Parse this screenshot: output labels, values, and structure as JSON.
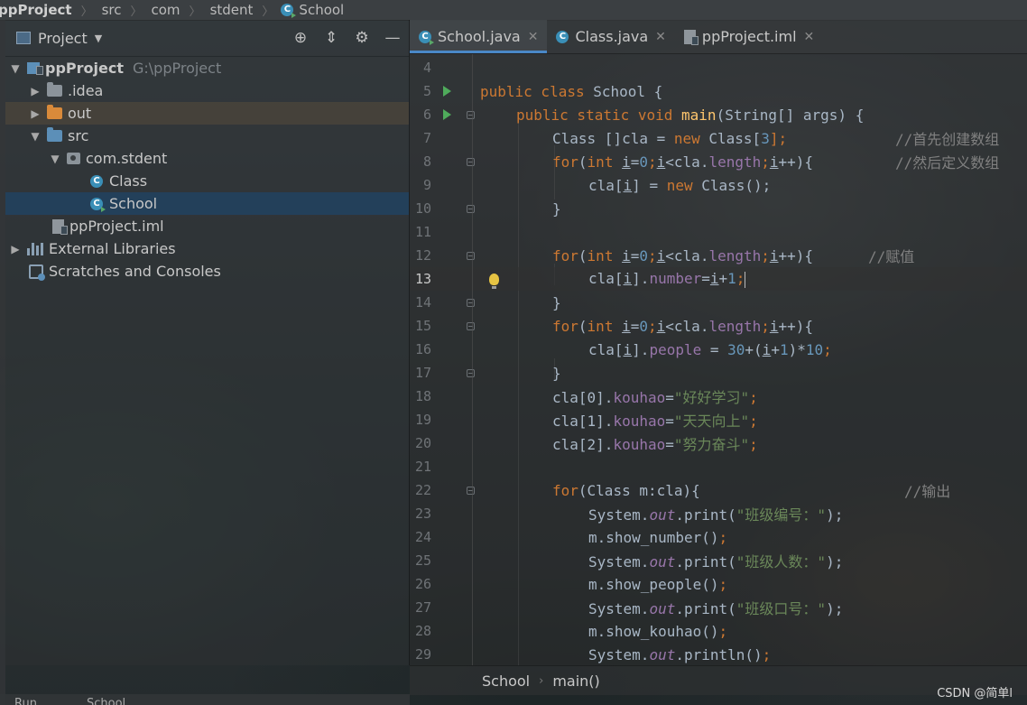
{
  "breadcrumb": [
    "ppProject",
    "src",
    "com",
    "stdent",
    "School"
  ],
  "project_panel": {
    "title": "Project",
    "tree": [
      {
        "label": "ppProject",
        "path": "G:\\ppProject"
      },
      {
        "label": ".idea"
      },
      {
        "label": "out"
      },
      {
        "label": "src"
      },
      {
        "label": "com.stdent"
      },
      {
        "label": "Class"
      },
      {
        "label": "School"
      },
      {
        "label": "ppProject.iml"
      },
      {
        "label": "External Libraries"
      },
      {
        "label": "Scratches and Consoles"
      }
    ]
  },
  "tabs": [
    {
      "label": "School.java",
      "active": true
    },
    {
      "label": "Class.java",
      "active": false
    },
    {
      "label": "ppProject.iml",
      "active": false
    }
  ],
  "line_numbers": [
    "4",
    "5",
    "6",
    "7",
    "8",
    "9",
    "10",
    "11",
    "12",
    "13",
    "14",
    "15",
    "16",
    "17",
    "18",
    "19",
    "20",
    "21",
    "22",
    "23",
    "24",
    "25",
    "26",
    "27",
    "28",
    "29"
  ],
  "code_text": {
    "l5_a": "public class ",
    "l5_b": "School {",
    "l6_a": "public static void ",
    "l6_b": "main(String[] args) {",
    "l7_a": "Class []cla = ",
    "l7_b": "new ",
    "l7_c": "Class[",
    "l7_d": "3",
    "l7_e": "];",
    "l7_cmt": "//首先创建数组",
    "l8_cmt": "//然后定义数组",
    "l9_a": "cla[",
    "l9_b": "i",
    "l9_c": "] = ",
    "l9_d": "new ",
    "l9_e": "Class();",
    "l10": "}",
    "l12_cmt": "//赋值",
    "l13_a": "cla[",
    "l13_b": "i",
    "l13_c": "].",
    "l13_d": "number",
    "l13_e": "=",
    "l13_f": "i",
    "l13_g": "+",
    "l13_h": "1",
    "l13_i": ";",
    "l14": "}",
    "l16_a": "cla[",
    "l16_b": "i",
    "l16_c": "].",
    "l16_d": "people",
    "l16_e": " = ",
    "l16_f": "30",
    "l16_g": "+(",
    "l16_h": "i",
    "l16_i": "+",
    "l16_j": "1",
    "l16_k": ")*",
    "l16_l": "10",
    "l16_m": ";",
    "l17": "}",
    "l18_a": "cla[0].",
    "l18_b": "kouhao",
    "l18_c": "=",
    "l18_d": "\"好好学习\"",
    "l18_e": ";",
    "l19_a": "cla[1].",
    "l19_b": "kouhao",
    "l19_c": "=",
    "l19_d": "\"天天向上\"",
    "l19_e": ";",
    "l20_a": "cla[2].",
    "l20_b": "kouhao",
    "l20_c": "=",
    "l20_d": "\"努力奋斗\"",
    "l20_e": ";",
    "l22_a": "for",
    "l22_b": "(Class m:cla){",
    "l22_cmt": "//输出",
    "l23_a": "System.",
    "l23_b": "out",
    "l23_c": ".print(",
    "l23_d": "\"班级编号：\"",
    "l23_e": ");",
    "l24_a": "m.show_number()",
    "l24_b": ";",
    "l25_a": "System.",
    "l25_b": "out",
    "l25_c": ".print(",
    "l25_d": "\"班级人数：\"",
    "l25_e": ");",
    "l26_a": "m.show_people()",
    "l26_b": ";",
    "l27_a": "System.",
    "l27_b": "out",
    "l27_c": ".print(",
    "l27_d": "\"班级口号：\"",
    "l27_e": ");",
    "l28_a": "m.show_kouhao()",
    "l28_b": ";",
    "l29_a": "System.",
    "l29_b": "out",
    "l29_c": ".println()",
    "l29_d": ";",
    "for_kw": "for",
    "int_kw": "int ",
    "loop_i": "i",
    "loop_eq0": "=",
    "loop_zero": "0",
    "loop_semi": ";",
    "loop_lt": "<cla.",
    "loop_len": "length",
    "loop_inc": "++){"
  },
  "bottom_breadcrumb": [
    "School",
    "main()"
  ],
  "status_left": [
    "Run",
    "School"
  ],
  "watermark": "CSDN @简单l"
}
